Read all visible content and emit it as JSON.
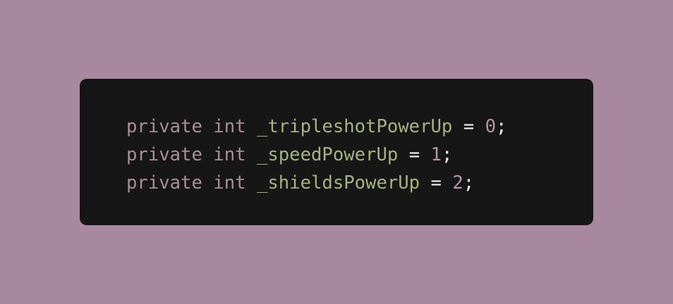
{
  "code_block": {
    "lines": [
      {
        "keyword": "private",
        "type": "int",
        "identifier": "_tripleshotPowerUp",
        "operator": "=",
        "value": "0",
        "terminator": ";"
      },
      {
        "keyword": "private",
        "type": "int",
        "identifier": "_speedPowerUp",
        "operator": "=",
        "value": "1",
        "terminator": ";"
      },
      {
        "keyword": "private",
        "type": "int",
        "identifier": "_shieldsPowerUp",
        "operator": "=",
        "value": "2",
        "terminator": ";"
      }
    ]
  },
  "colors": {
    "background": "#a8889e",
    "card": "#161616",
    "keyword": "#a89098",
    "identifier": "#a6b27f",
    "number": "#b696a6",
    "operator": "#f0f0f0"
  }
}
